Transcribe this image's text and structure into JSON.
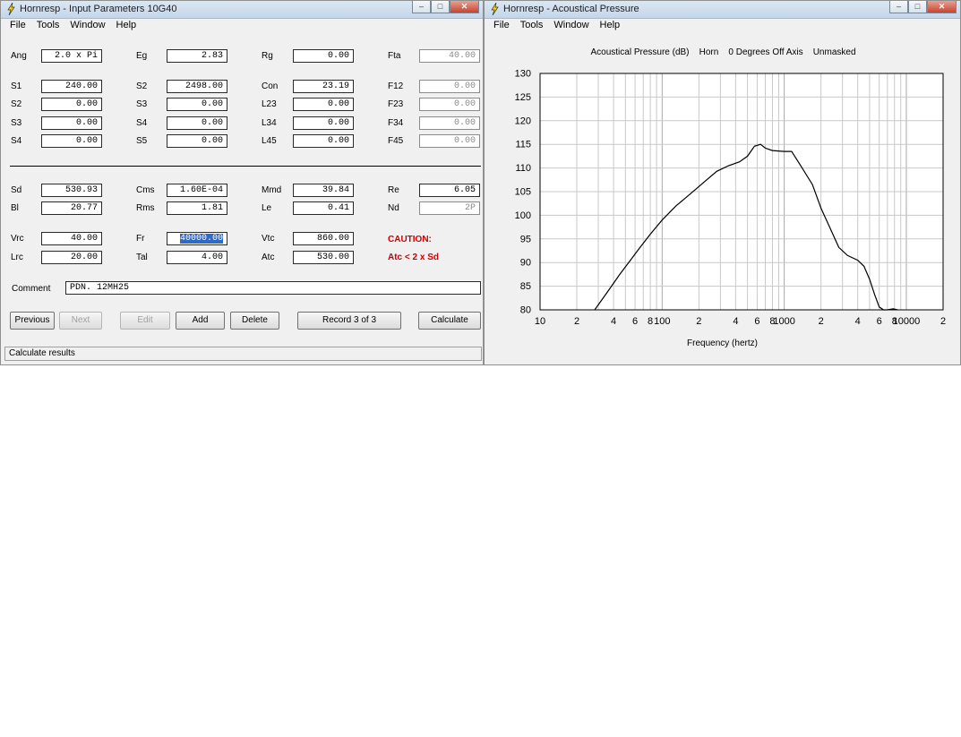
{
  "input_window": {
    "title": "Hornresp - Input Parameters   10G40",
    "window_buttons": {
      "minimize": "–",
      "maximize": "□",
      "close": "✕"
    },
    "menu": [
      "File",
      "Tools",
      "Window",
      "Help"
    ],
    "section1": [
      {
        "label": "Ang",
        "value": "2.0 x Pi"
      },
      {
        "label": "Eg",
        "value": "2.83"
      },
      {
        "label": "Rg",
        "value": "0.00"
      },
      {
        "label": "Fta",
        "value": "40.00",
        "disabled": true
      },
      {
        "label": "S1",
        "value": "240.00"
      },
      {
        "label": "S2",
        "value": "2498.00"
      },
      {
        "label": "Con",
        "value": "23.19"
      },
      {
        "label": "F12",
        "value": "0.00",
        "disabled": true
      },
      {
        "label": "S2",
        "value": "0.00"
      },
      {
        "label": "S3",
        "value": "0.00"
      },
      {
        "label": "L23",
        "value": "0.00"
      },
      {
        "label": "F23",
        "value": "0.00",
        "disabled": true
      },
      {
        "label": "S3",
        "value": "0.00"
      },
      {
        "label": "S4",
        "value": "0.00"
      },
      {
        "label": "L34",
        "value": "0.00"
      },
      {
        "label": "F34",
        "value": "0.00",
        "disabled": true
      },
      {
        "label": "S4",
        "value": "0.00"
      },
      {
        "label": "S5",
        "value": "0.00"
      },
      {
        "label": "L45",
        "value": "0.00"
      },
      {
        "label": "F45",
        "value": "0.00",
        "disabled": true
      }
    ],
    "section2": [
      {
        "label": "Sd",
        "value": "530.93"
      },
      {
        "label": "Cms",
        "value": "1.60E-04"
      },
      {
        "label": "Mmd",
        "value": "39.84"
      },
      {
        "label": "Re",
        "value": "6.05"
      },
      {
        "label": "Bl",
        "value": "20.77"
      },
      {
        "label": "Rms",
        "value": "1.81"
      },
      {
        "label": "Le",
        "value": "0.41"
      },
      {
        "label": "Nd",
        "value": "2P",
        "disabled": true
      },
      {
        "label": "Vrc",
        "value": "40.00"
      },
      {
        "label": "Fr",
        "value": "40000.00",
        "selected": true
      },
      {
        "label": "Vtc",
        "value": "860.00"
      },
      {
        "label": "Lrc",
        "value": "20.00"
      },
      {
        "label": "Tal",
        "value": "4.00"
      },
      {
        "label": "Atc",
        "value": "530.00"
      }
    ],
    "caution": {
      "title": "CAUTION:",
      "text": "Atc < 2 x Sd"
    },
    "comment": {
      "label": "Comment",
      "value": "PDN. 12MH25"
    },
    "buttons": {
      "previous": "Previous",
      "next": "Next",
      "edit": "Edit",
      "add": "Add",
      "delete": "Delete",
      "record": "Record 3 of 3",
      "calculate": "Calculate"
    },
    "status": "Calculate results"
  },
  "chart_window": {
    "title": "Hornresp - Acoustical Pressure",
    "window_buttons": {
      "minimize": "–",
      "maximize": "□",
      "close": "✕"
    },
    "menu": [
      "File",
      "Tools",
      "Window",
      "Help"
    ]
  },
  "colors": {
    "curve": "#000000",
    "grid": "#c8c8c8",
    "caution": "#cc0000",
    "selection": "#316ac5"
  },
  "chart_data": {
    "type": "line",
    "title": "Acoustical Pressure (dB)    Horn    0 Degrees Off Axis    Unmasked",
    "xlabel": "Frequency (hertz)",
    "ylabel": "",
    "xscale": "log",
    "xlim": [
      10,
      20000
    ],
    "ylim": [
      80,
      130
    ],
    "yticks": [
      "80",
      "85",
      "90",
      "95",
      "100",
      "105",
      "110",
      "115",
      "120",
      "125",
      "130"
    ],
    "xticks": [
      {
        "x": 10,
        "label": "10"
      },
      {
        "x": 20,
        "label": "2"
      },
      {
        "x": 40,
        "label": "4"
      },
      {
        "x": 60,
        "label": "6"
      },
      {
        "x": 80,
        "label": "8"
      },
      {
        "x": 100,
        "label": "100"
      },
      {
        "x": 200,
        "label": "2"
      },
      {
        "x": 400,
        "label": "4"
      },
      {
        "x": 600,
        "label": "6"
      },
      {
        "x": 800,
        "label": "8"
      },
      {
        "x": 1000,
        "label": "1000"
      },
      {
        "x": 2000,
        "label": "2"
      },
      {
        "x": 4000,
        "label": "4"
      },
      {
        "x": 6000,
        "label": "6"
      },
      {
        "x": 8000,
        "label": "8"
      },
      {
        "x": 10000,
        "label": "10000"
      },
      {
        "x": 20000,
        "label": "2"
      }
    ],
    "grid": true,
    "series": [
      {
        "x": [
          28,
          35,
          45,
          55,
          65,
          80,
          100,
          130,
          170,
          220,
          280,
          350,
          430,
          500,
          570,
          640,
          700,
          800,
          1000,
          1150,
          1400,
          1700,
          2000,
          2400,
          2800,
          3300,
          4000,
          4500,
          5000,
          5500,
          6000,
          6500,
          7000,
          7800,
          8500
        ],
        "y": [
          80,
          83.5,
          87.5,
          90.5,
          93,
          96,
          99,
          102,
          104.5,
          107,
          109.3,
          110.5,
          111.3,
          112.5,
          114.6,
          115,
          114.2,
          113.7,
          113.5,
          113.5,
          110,
          106.5,
          101.5,
          97,
          93.2,
          91.5,
          90.5,
          89.2,
          86.5,
          83.2,
          80.6,
          80,
          80,
          80.2,
          80
        ]
      }
    ]
  }
}
